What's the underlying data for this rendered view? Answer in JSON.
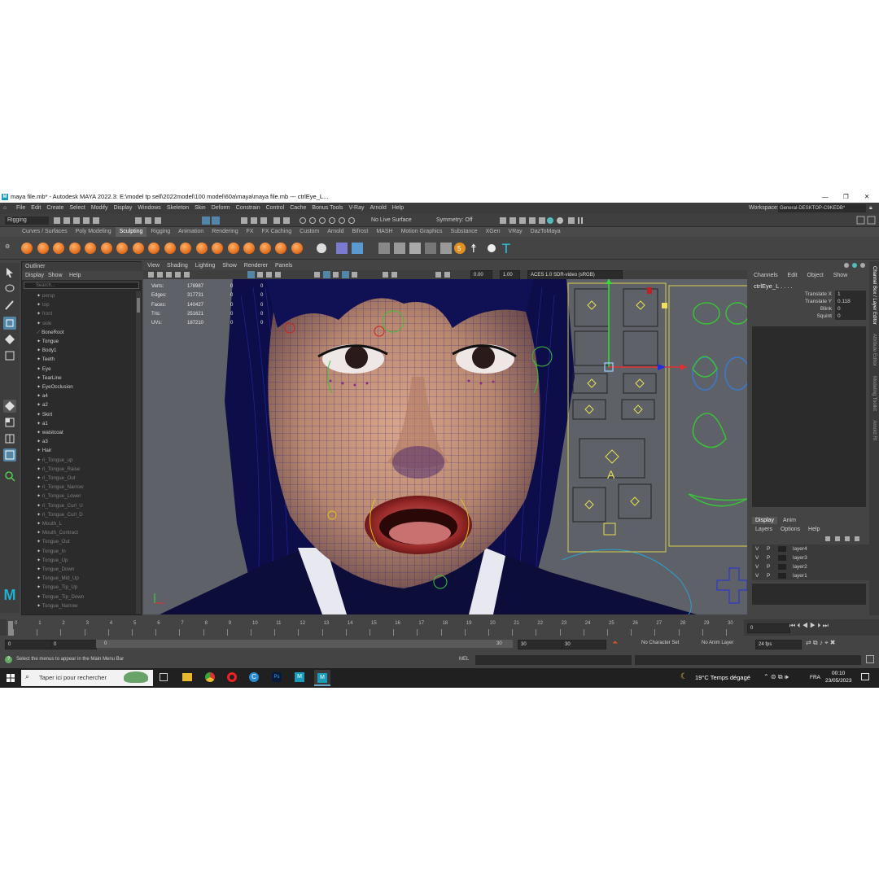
{
  "window": {
    "title": "maya file.mb* - Autodesk MAYA 2022.3: E:\\model tp sell\\2022model\\100 model\\60a\\maya\\maya file.mb  ---  ctrlEye_L...",
    "controls": [
      "—",
      "❐",
      "✕"
    ]
  },
  "menubar": {
    "items": [
      "File",
      "Edit",
      "Create",
      "Select",
      "Modify",
      "Display",
      "Windows",
      "Skeleton",
      "Skin",
      "Deform",
      "Constrain",
      "Control",
      "Cache",
      "Bonus Tools",
      "V-Ray",
      "Arnold",
      "Help"
    ],
    "workspace_label": "Workspace:",
    "workspace_value": "General-DESKTOP-C9KEDB*"
  },
  "statusline": {
    "mode": "Rigging",
    "live_surface": "No Live Surface",
    "symmetry": "Symmetry: Off"
  },
  "shelf": {
    "tabs": [
      "Curves / Surfaces",
      "Poly Modeling",
      "Sculpting",
      "Rigging",
      "Animation",
      "Rendering",
      "FX",
      "FX Caching",
      "Custom",
      "Arnold",
      "Bifrost",
      "MASH",
      "Motion Graphics",
      "Substance",
      "XGen",
      "VRay",
      "DazToMaya"
    ],
    "active_tab": "Sculpting"
  },
  "outliner": {
    "title": "Outliner",
    "menu": [
      "Display",
      "Show",
      "Help"
    ],
    "search_placeholder": "Search...",
    "items": [
      "persp",
      "top",
      "front",
      "side",
      "BoneRoot",
      "Tongue",
      "Body1",
      "Teeth",
      "Eye",
      "TearLine",
      "EyeOcclusion",
      "a4",
      "a2",
      "Skirt",
      "a1",
      "waistcoat",
      "a3",
      "Hair",
      "ri_Tongue_up",
      "ri_Tongue_Raise",
      "ri_Tongue_Out",
      "ri_Tongue_Narrow",
      "ri_Tongue_Lower",
      "ri_Tongue_Curl_U",
      "ri_Tongue_Curl_D",
      "Mouth_L",
      "Mouth_Contract",
      "Tongue_Out",
      "Tongue_In",
      "Tongue_Up",
      "Tongue_Down",
      "Tongue_Mid_Up",
      "Tongue_Tip_Up",
      "Tongue_Tip_Down",
      "Tongue_Narrow"
    ]
  },
  "viewport": {
    "menu": [
      "View",
      "Shading",
      "Lighting",
      "Show",
      "Renderer",
      "Panels"
    ],
    "exposure": "0.00",
    "gamma": "1.00",
    "colorspace": "ACES 1.0 SDR-video (sRGB)",
    "hud": [
      {
        "label": "Verts:",
        "v1": "178987",
        "v2": "0",
        "v3": "0"
      },
      {
        "label": "Edges:",
        "v1": "317731",
        "v2": "0",
        "v3": "0"
      },
      {
        "label": "Faces:",
        "v1": "140427",
        "v2": "0",
        "v3": "0"
      },
      {
        "label": "Tris:",
        "v1": "251621",
        "v2": "0",
        "v3": "0"
      },
      {
        "label": "UVs:",
        "v1": "187210",
        "v2": "0",
        "v3": "0"
      }
    ],
    "facial_panel_letter": "A"
  },
  "channelbox": {
    "menu": [
      "Channels",
      "Edit",
      "Object",
      "Show"
    ],
    "object": "ctrlEye_L . . . .",
    "attributes": [
      {
        "name": "Translate X",
        "value": "1"
      },
      {
        "name": "Translate Y",
        "value": "0.118"
      },
      {
        "name": "Blink",
        "value": "0"
      },
      {
        "name": "Squint",
        "value": "0"
      }
    ],
    "side_tabs": [
      "Channel Box / Layer Editor",
      "Attribute Editor",
      "Modeling Toolkit",
      "Arnold RI"
    ]
  },
  "layers": {
    "tabs": [
      "Display",
      "Anim"
    ],
    "menu": [
      "Layers",
      "Options",
      "Help"
    ],
    "rows": [
      {
        "v": "V",
        "p": "P",
        "name": "layer4"
      },
      {
        "v": "V",
        "p": "P",
        "name": "layer3"
      },
      {
        "v": "V",
        "p": "P",
        "name": "layer2"
      },
      {
        "v": "V",
        "p": "P",
        "name": "layer1"
      }
    ]
  },
  "timeline": {
    "ticks": [
      "0",
      "1",
      "2",
      "3",
      "4",
      "5",
      "6",
      "7",
      "8",
      "9",
      "10",
      "11",
      "12",
      "13",
      "14",
      "15",
      "16",
      "17",
      "18",
      "19",
      "20",
      "21",
      "22",
      "23",
      "24",
      "25",
      "26",
      "27",
      "28",
      "29",
      "30"
    ],
    "current_frame": "0"
  },
  "range": {
    "start": "0",
    "start2": "0",
    "slider_start": "0",
    "slider_end": "30",
    "end": "30",
    "end2": "30",
    "character_set": "No Character Set",
    "anim_layer": "No Anim Layer",
    "fps": "24 fps"
  },
  "cmdline": {
    "help_text": "Select the menus to appear in the Main Menu Bar",
    "lang": "MEL"
  },
  "taskbar": {
    "search_placeholder": "Taper ici pour rechercher",
    "weather": "19°C  Temps dégagé",
    "lang": "FRA",
    "time": "00:10",
    "date": "23/05/2023"
  },
  "colors": {
    "maya_bg": "#444444",
    "accent": "#5285a6",
    "wireframe": "#1a1aa0",
    "shelf_ball": "#e06a1a"
  }
}
